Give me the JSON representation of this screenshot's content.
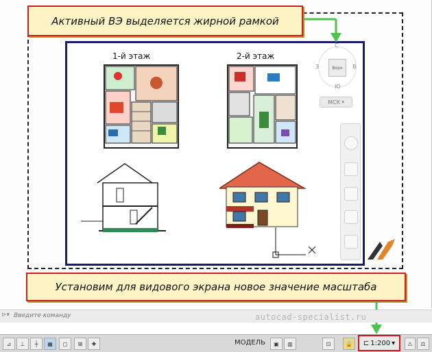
{
  "callouts": {
    "top": "Активный ВЭ выделяется жирной рамкой",
    "bottom": "Установим для видового экрана новое значение масштаба"
  },
  "drawing": {
    "floor1_label": "1-й этаж",
    "floor2_label": "2-й этаж"
  },
  "viewcube": {
    "north": "С",
    "south": "Ю",
    "west": "З",
    "east": "В",
    "face": "Верх",
    "ucs_label": "МСК"
  },
  "command_line": {
    "placeholder": "Введите команду",
    "watermark": "autocad-specialist.ru"
  },
  "status_bar": {
    "model_label": "МОДЕЛЬ",
    "scale_value": "1:200"
  },
  "colors": {
    "callout_border": "#cc1f1f",
    "callout_fill": "#fdf3c4",
    "viewport_border": "#1a1a6e",
    "arrow_green": "#4fc24f"
  }
}
